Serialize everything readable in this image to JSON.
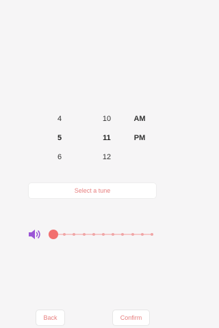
{
  "picker": {
    "hours": [
      "4",
      "5",
      "6"
    ],
    "minutes": [
      "10",
      "11",
      "12"
    ],
    "ampm": [
      "AM",
      "PM"
    ],
    "selected_hour": "5",
    "selected_minute": "11",
    "selected_period": "PM"
  },
  "tune": {
    "label": "Select a tune"
  },
  "volume": {
    "level": 0.0,
    "icon": "speaker-icon",
    "ticks": 10
  },
  "colors": {
    "accent": "#f26f6f",
    "text_accent": "#e77f7f",
    "icon": "#9b55d6"
  },
  "nav": {
    "back_label": "Back",
    "confirm_label": "Confirm"
  }
}
